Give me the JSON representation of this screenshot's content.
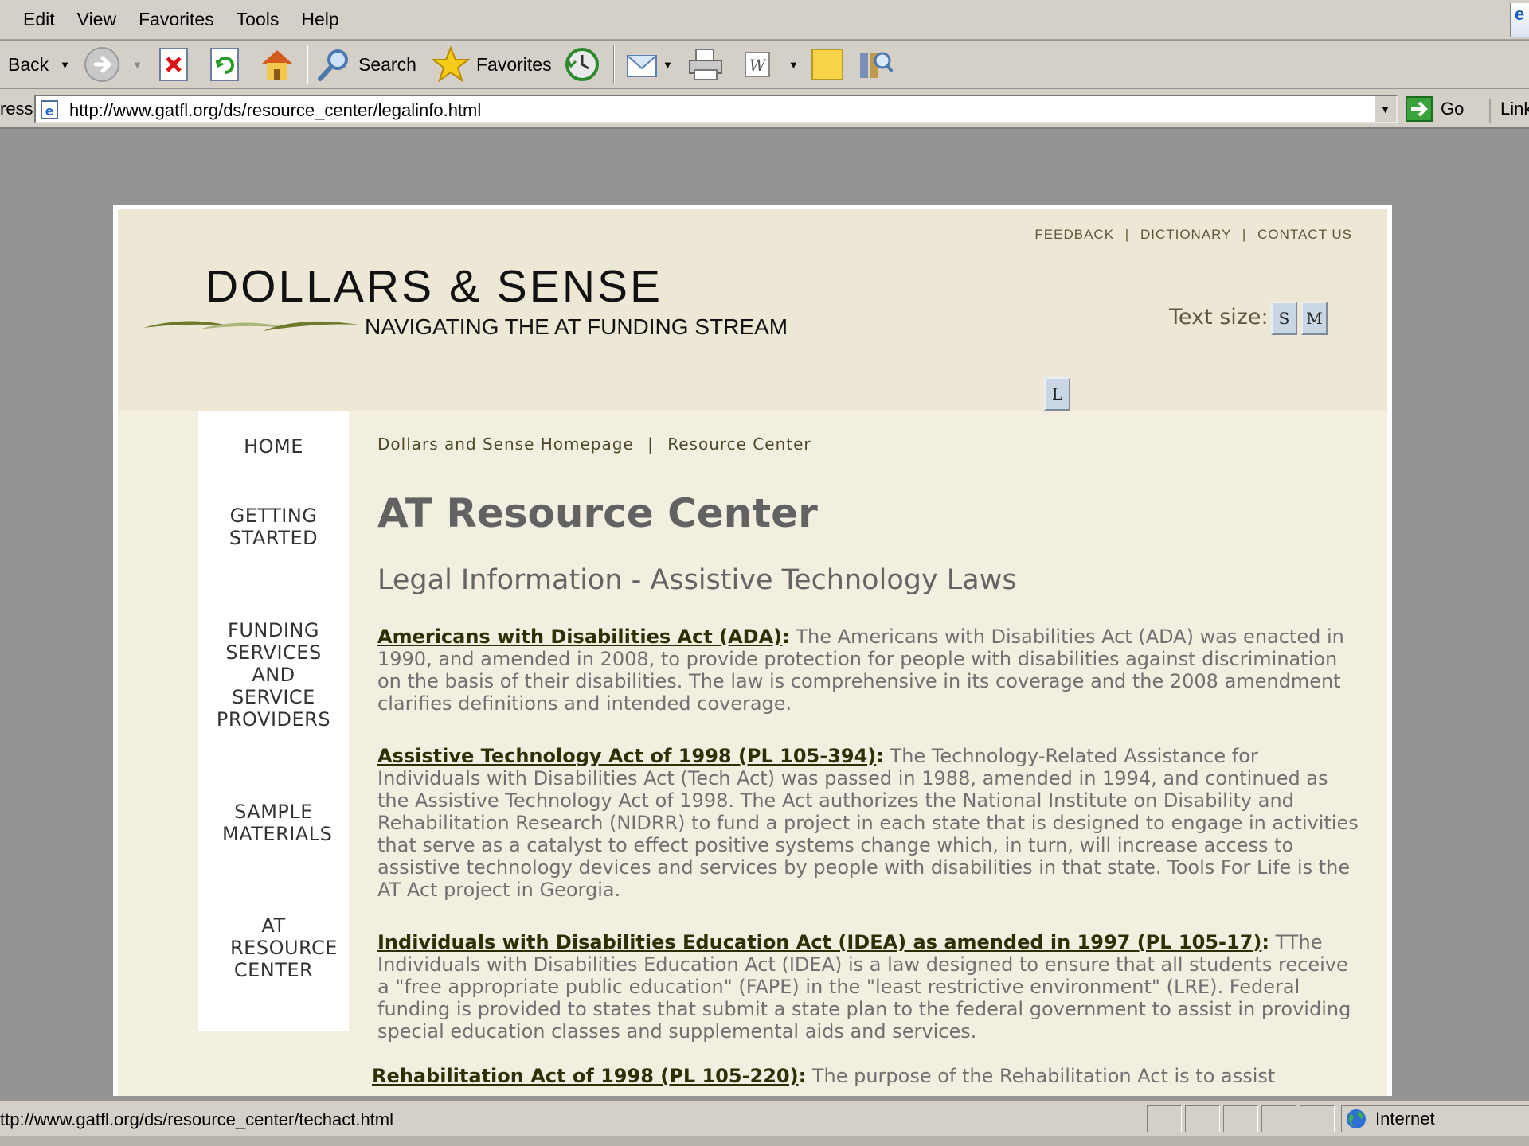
{
  "browser": {
    "menu": [
      "Edit",
      "View",
      "Favorites",
      "Tools",
      "Help"
    ],
    "toolbar": {
      "back": "Back",
      "search": "Search",
      "favorites": "Favorites",
      "go": "Go",
      "links": "Link"
    },
    "address_label": "ress",
    "address_url": "http://www.gatfl.org/ds/resource_center/legalinfo.html",
    "status_text": "ttp://www.gatfl.org/ds/resource_center/techact.html",
    "zone": "Internet"
  },
  "site": {
    "top_links": [
      "FEEDBACK",
      "DICTIONARY",
      "CONTACT US"
    ],
    "top_links_sep": "|",
    "logo_title": "DOLLARS & SENSE",
    "logo_subtitle": "NAVIGATING THE AT FUNDING STREAM",
    "text_size_label": "Text size:",
    "text_size_buttons": [
      "S",
      "M",
      "L"
    ],
    "nav": [
      "HOME",
      "GETTING STARTED",
      "FUNDING SERVICES AND SERVICE PROVIDERS",
      "SAMPLE MATERIALS",
      "AT RESOURCE CENTER"
    ],
    "breadcrumb": [
      "Dollars and Sense Homepage",
      "Resource Center"
    ],
    "breadcrumb_sep": "|",
    "page_title": "AT Resource Center",
    "page_subtitle": "Legal Information - Assistive Technology Laws",
    "laws": [
      {
        "title": "Americans with Disabilities Act (ADA)",
        "text": "The Americans with Disabilities Act (ADA) was enacted in 1990, and amended in 2008, to provide protection for people with disabilities against discrimination on the basis of their disabilities. The law is comprehensive in its coverage and the 2008 amendment clarifies definitions and intended coverage."
      },
      {
        "title": "Assistive Technology Act of 1998 (PL 105-394)",
        "text": "The Technology-Related Assistance for Individuals with Disabilities Act (Tech Act) was passed in 1988, amended in 1994, and continued as the Assistive Technology Act of 1998. The Act authorizes the National Institute on Disability and Rehabilitation Research (NIDRR) to fund a project in each state that is designed to engage in activities that serve as a catalyst to effect positive systems change which, in turn, will increase access to assistive technology devices and services by people with disabilities in that state. Tools For Life is the AT Act project in Georgia."
      },
      {
        "title": "Individuals with Disabilities Education Act (IDEA) as amended in 1997 (PL 105-17)",
        "text": "TThe Individuals with Disabilities Education Act (IDEA) is a law designed to ensure that all students receive a \"free appropriate public education\" (FAPE) in the \"least restrictive environment\" (LRE). Federal funding is provided to states that submit a state plan to the federal government to assist in providing special education classes and supplemental aids and services."
      },
      {
        "title": "Rehabilitation Act of 1998 (PL 105-220)",
        "text": "The purpose of the Rehabilitation Act is to assist"
      }
    ]
  }
}
